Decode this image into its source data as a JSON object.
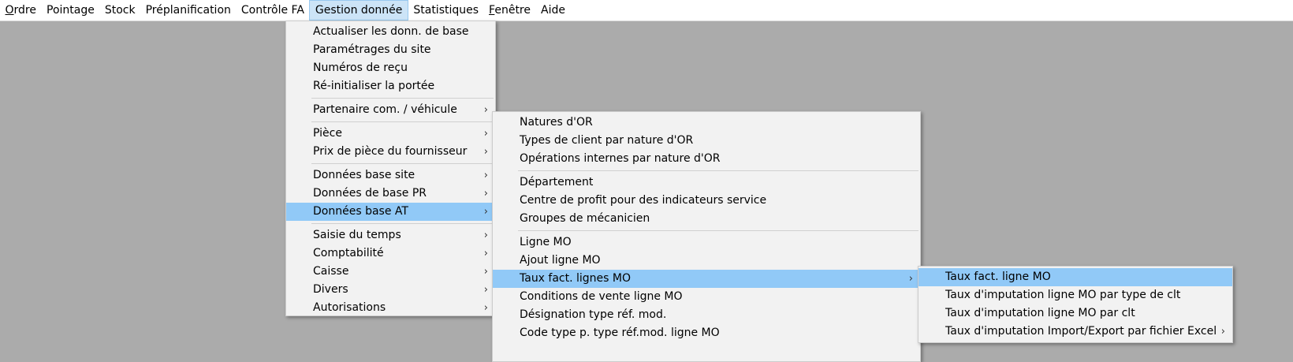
{
  "menubar": {
    "items": [
      {
        "label_mn": "O",
        "label_rest": "rdre"
      },
      {
        "label": "Pointage"
      },
      {
        "label": "Stock"
      },
      {
        "label": "Préplanification"
      },
      {
        "label": "Contrôle FA"
      },
      {
        "label": "Gestion donnée",
        "active": true
      },
      {
        "label": "Statistiques"
      },
      {
        "label_mn": "F",
        "label_rest": "enêtre"
      },
      {
        "label": "Aide"
      }
    ]
  },
  "menu1": {
    "groups": [
      [
        "Actualiser les donn. de base",
        "Paramétrages du site",
        "Numéros de reçu",
        "Ré-initialiser la portée"
      ],
      [
        "Partenaire com. / véhicule"
      ],
      [
        "Pièce",
        "Prix de pièce du fournisseur"
      ],
      [
        "Données base site",
        "Données de base PR",
        "Données base AT"
      ],
      [
        "Saisie du temps",
        "Comptabilité",
        "Caisse",
        "Divers",
        "Autorisations"
      ]
    ],
    "highlighted": "Données base AT"
  },
  "menu2": {
    "groups": [
      [
        "Natures d'OR",
        "Types de client par nature d'OR",
        "Opérations internes par nature d'OR"
      ],
      [
        "Département",
        "Centre de profit pour des indicateurs service",
        "Groupes de mécanicien"
      ],
      [
        "Ligne MO",
        "Ajout ligne MO",
        "Taux fact. lignes MO",
        "Conditions de vente ligne MO",
        "Désignation type réf. mod.",
        "Code type p. type réf.mod. ligne MO"
      ]
    ],
    "highlighted": "Taux fact. lignes MO"
  },
  "menu3": {
    "items": [
      "Taux fact. ligne MO",
      "Taux d'imputation ligne MO par type de clt",
      "Taux d'imputation ligne MO par clt",
      "Taux d'imputation Import/Export par fichier Excel"
    ],
    "highlighted": "Taux fact. ligne MO"
  },
  "icons": {
    "submenu_arrow": "chevron-right-icon",
    "submenu_glyph": "›"
  },
  "colors": {
    "desktop_bg": "#ababab",
    "menu_bg": "#f2f2f2",
    "highlight": "#91c9f7",
    "menubar_active": "#cce4f7"
  }
}
